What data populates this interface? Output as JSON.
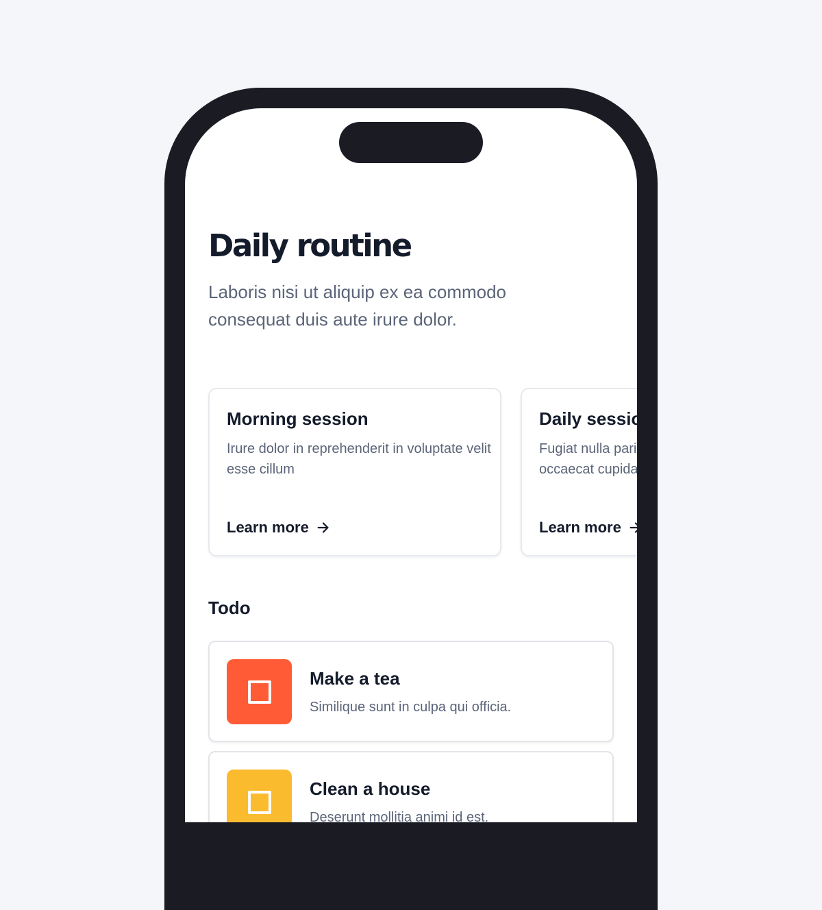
{
  "page": {
    "title": "Daily routine",
    "subtitle": "Laboris nisi ut aliquip ex ea commodo consequat duis aute irure dolor."
  },
  "sessions": [
    {
      "title": "Morning session",
      "description": "Irure dolor in reprehenderit in voluptate velit esse cillum",
      "link_label": "Learn more",
      "link_icon": "arrow-right-icon"
    },
    {
      "title": "Daily session",
      "description": "Fugiat nulla pariatur excepteur sint occaecat cupidatat",
      "link_label": "Learn more",
      "link_icon": "arrow-right-icon"
    }
  ],
  "todo": {
    "label": "Todo",
    "items": [
      {
        "title": "Make a tea",
        "description": "Similique sunt in culpa qui officia.",
        "color": "#ff5b37",
        "icon": "checkbox-icon"
      },
      {
        "title": "Clean a house",
        "description": "Deserunt mollitia animi id est.",
        "color": "#fbbb2f",
        "icon": "checkbox-icon"
      }
    ]
  },
  "colors": {
    "background": "#f4f6f9",
    "phone_frame": "#1b1c23",
    "text_primary": "#141b2b",
    "text_secondary": "#5b6478"
  }
}
